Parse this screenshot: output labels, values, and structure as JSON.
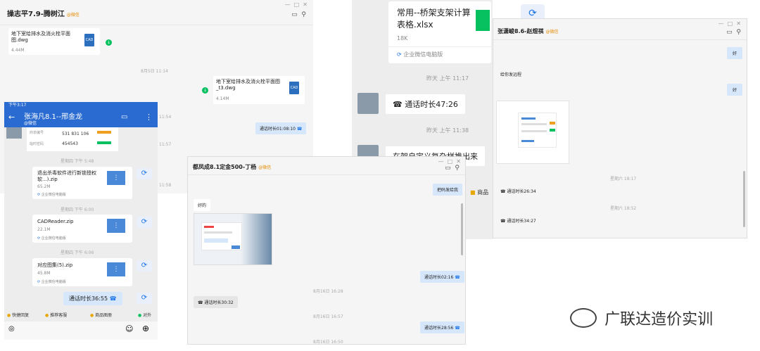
{
  "win1": {
    "title": "操志平7.9-腾树江",
    "badge": "@微信",
    "file1": {
      "name": "地下室给排水及消火栓平面图.dwg",
      "size": "4.44M"
    },
    "time1": "8月5日 11:14",
    "file2": {
      "name": "地下室给排水及消火栓平面图_t3.dwg",
      "size": "4.14M"
    },
    "time2": "11:54",
    "call": "通话时长01:08:10",
    "time3": "11:57",
    "time4": "11:58"
  },
  "win2": {
    "status_time": "下午3:17",
    "title": "张海凡8.1--邢金龙",
    "subtitle": "@微信",
    "table": [
      {
        "label": "商单编号",
        "value": "531 831 106"
      },
      {
        "label": "临时密码",
        "value": "454543"
      }
    ],
    "time1": "星期四 下午 5:48",
    "file1": {
      "name": "退出杀毒软件进行新锁授权软...).zip",
      "size": "65.2M"
    },
    "source": "企业微信电脑版",
    "time2": "星期四 下午 6:00",
    "file2": {
      "name": "CADReader.zip",
      "size": "22.1M"
    },
    "time3": "星期四 下午 6:06",
    "file3": {
      "name": "对应图集(5).zip",
      "size": "45.8M"
    },
    "call": "通话时长36:55",
    "quick": [
      "快捷回复",
      "推荐客服",
      "商品图册",
      "对外"
    ]
  },
  "win3": {
    "file": {
      "name": "常用--桥架支架计算表格.xlsx",
      "size": "18K"
    },
    "source": "企业微信电脑版",
    "time1": "昨天 上午 11:17",
    "call": "通话时长47:26",
    "time2": "昨天 上午 11:38",
    "msg": "在架自定义复杂样推出来",
    "product": "商品"
  },
  "win4": {
    "title": "张潇峻8.6-赵煜祺",
    "badge": "@微信",
    "msg1": "好",
    "msg2": "给你发远程",
    "msg3": "好",
    "time1": "星期六 18:17",
    "call1": "通话时长26:34",
    "time2": "星期六 18:52",
    "call2": "通话时长34:27"
  },
  "win5": {
    "title": "都凤成8.1定金500-丁杨",
    "badge": "@微信",
    "msg1": "把码发给我",
    "msg2": "好的",
    "call1": "通话时长02:16",
    "time1": "8月16日 16:28",
    "call2": "通话时长30:32",
    "time2": "8月16日 16:57",
    "call3": "通话时长28:56",
    "time3": "8月16日 16:50"
  },
  "brand": {
    "name": "广联达造价实训"
  },
  "colors": {
    "accent": "#1a73e8",
    "wechat_green": "#07c160",
    "bubble_blue": "#d6e7fb"
  }
}
